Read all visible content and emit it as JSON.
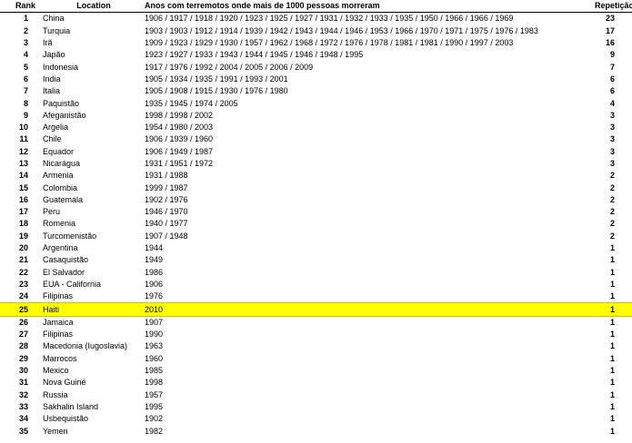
{
  "columns": {
    "rank": "Rank",
    "location": "Location",
    "years": "Anos com terremotos onde mais de 1000 pessoas morreram",
    "repeats": "Repetição"
  },
  "highlight_color": "#ffff00",
  "rows": [
    {
      "rank": "1",
      "location": "China",
      "years": "1906 / 1917 / 1918 / 1920 / 1923 / 1925 / 1927 / 1931 / 1932 / 1933 / 1935 / 1950 / 1966 / 1966 / 1969",
      "repeats": "23"
    },
    {
      "rank": "2",
      "location": "Turquia",
      "years": "1903 / 1903 / 1912 / 1914 / 1939 / 1942 / 1943 / 1944 / 1946 / 1953 / 1966 / 1970 / 1971 / 1975 / 1976 / 1983",
      "repeats": "17"
    },
    {
      "rank": "3",
      "location": "Irã",
      "years": "1909 / 1923 / 1929 / 1930 / 1957 / 1962 / 1968 / 1972 / 1976 / 1978 / 1981 / 1981 / 1990 / 1997 / 2003",
      "repeats": "16"
    },
    {
      "rank": "4",
      "location": "Japão",
      "years": "1923 / 1927 / 1933 / 1943 / 1944 / 1945 / 1946 / 1948 / 1995",
      "repeats": "9"
    },
    {
      "rank": "5",
      "location": "Indonesia",
      "years": "1917 / 1976 / 1992 / 2004 / 2005 / 2006 / 2009",
      "repeats": "7"
    },
    {
      "rank": "6",
      "location": "India",
      "years": "1905 / 1934 / 1935 / 1991 / 1993 / 2001",
      "repeats": "6"
    },
    {
      "rank": "7",
      "location": "Italia",
      "years": "1905 / 1908 / 1915 / 1930 / 1976 / 1980",
      "repeats": "6"
    },
    {
      "rank": "8",
      "location": "Paquistão",
      "years": "1935 / 1945 / 1974 / 2005",
      "repeats": "4"
    },
    {
      "rank": "9",
      "location": "Afeganistão",
      "years": "1998 / 1998 / 2002",
      "repeats": "3"
    },
    {
      "rank": "10",
      "location": "Argelia",
      "years": "1954 / 1980 / 2003",
      "repeats": "3"
    },
    {
      "rank": "11",
      "location": "Chile",
      "years": "1906 / 1939 / 1960",
      "repeats": "3"
    },
    {
      "rank": "12",
      "location": "Equador",
      "years": "1906 / 1949 / 1987",
      "repeats": "3"
    },
    {
      "rank": "13",
      "location": "Nicarágua",
      "years": "1931 / 1951 / 1972",
      "repeats": "3"
    },
    {
      "rank": "14",
      "location": "Armenia",
      "years": "1931 / 1988",
      "repeats": "2"
    },
    {
      "rank": "15",
      "location": "Colombia",
      "years": "1999 / 1987",
      "repeats": "2"
    },
    {
      "rank": "16",
      "location": "Guatemala",
      "years": "1902 / 1976",
      "repeats": "2"
    },
    {
      "rank": "17",
      "location": "Peru",
      "years": "1946 / 1970",
      "repeats": "2"
    },
    {
      "rank": "18",
      "location": "Romenia",
      "years": "1940 / 1977",
      "repeats": "2"
    },
    {
      "rank": "19",
      "location": "Turcomenistão",
      "years": "1907 / 1948",
      "repeats": "2"
    },
    {
      "rank": "20",
      "location": "Argentina",
      "years": "1944",
      "repeats": "1"
    },
    {
      "rank": "21",
      "location": "Casaquistão",
      "years": "1949",
      "repeats": "1"
    },
    {
      "rank": "22",
      "location": "El Salvador",
      "years": "1986",
      "repeats": "1"
    },
    {
      "rank": "23",
      "location": "EUA - California",
      "years": "1906",
      "repeats": "1"
    },
    {
      "rank": "24",
      "location": "Filipinas",
      "years": "1976",
      "repeats": "1"
    },
    {
      "rank": "25",
      "location": "Haiti",
      "years": "2010",
      "repeats": "1",
      "highlight": true
    },
    {
      "rank": "26",
      "location": "Jamaica",
      "years": "1907",
      "repeats": "1"
    },
    {
      "rank": "27",
      "location": "Filipinas",
      "years": "1990",
      "repeats": "1"
    },
    {
      "rank": "28",
      "location": "Macedonia (Iugoslavia)",
      "years": "1963",
      "repeats": "1"
    },
    {
      "rank": "29",
      "location": "Marrocos",
      "years": "1960",
      "repeats": "1"
    },
    {
      "rank": "30",
      "location": "Mexico",
      "years": "1985",
      "repeats": "1"
    },
    {
      "rank": "31",
      "location": "Nova Guiné",
      "years": "1998",
      "repeats": "1"
    },
    {
      "rank": "32",
      "location": "Russia",
      "years": "1957",
      "repeats": "1"
    },
    {
      "rank": "33",
      "location": "Sakhalin Island",
      "years": "1995",
      "repeats": "1"
    },
    {
      "rank": "34",
      "location": "Usbequistão",
      "years": "1902",
      "repeats": "1"
    },
    {
      "rank": "35",
      "location": "Yemen",
      "years": "1982",
      "repeats": "1"
    }
  ]
}
